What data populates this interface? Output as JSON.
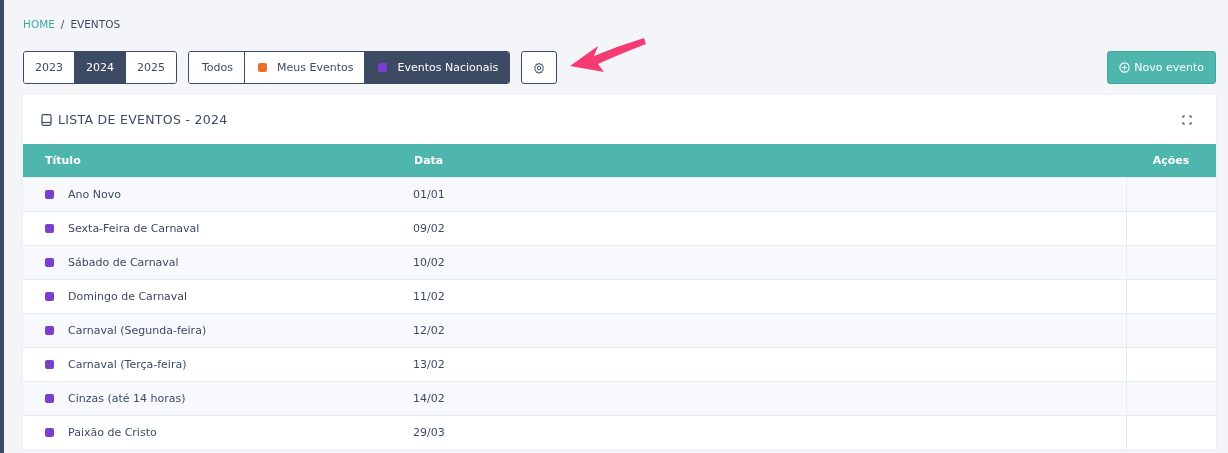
{
  "breadcrumb": [
    {
      "label": "HOME",
      "link": true
    },
    {
      "label": "EVENTOS",
      "link": false
    }
  ],
  "separator": "/",
  "years": [
    {
      "label": "2023",
      "selected": false
    },
    {
      "label": "2024",
      "selected": true
    },
    {
      "label": "2025",
      "selected": false
    }
  ],
  "filters": [
    {
      "label": "Todos",
      "selected": false
    },
    {
      "label": "Meus Eventos",
      "selected": false,
      "color": "#e8702f"
    },
    {
      "label": "Eventos Nacionais",
      "selected": true,
      "color": "#7b3fd0"
    }
  ],
  "new_button": "Novo evento",
  "card": {
    "title": "LISTA DE EVENTOS - 2024",
    "columns": [
      "Título",
      "Data",
      "Ações"
    ],
    "rows": [
      {
        "title": "Ano Novo",
        "date": "01/01",
        "color": "#7b3fd0"
      },
      {
        "title": "Sexta-Feira de Carnaval",
        "date": "09/02",
        "color": "#7b3fd0"
      },
      {
        "title": "Sábado de Carnaval",
        "date": "10/02",
        "color": "#7b3fd0"
      },
      {
        "title": "Domingo de Carnaval",
        "date": "11/02",
        "color": "#7b3fd0"
      },
      {
        "title": "Carnaval (Segunda-feira)",
        "date": "12/02",
        "color": "#7b3fd0"
      },
      {
        "title": "Carnaval (Terça-feira)",
        "date": "13/02",
        "color": "#7b3fd0"
      },
      {
        "title": "Cinzas (até 14 horas)",
        "date": "14/02",
        "color": "#7b3fd0"
      },
      {
        "title": "Paixão de Cristo",
        "date": "29/03",
        "color": "#7b3fd0"
      }
    ]
  }
}
